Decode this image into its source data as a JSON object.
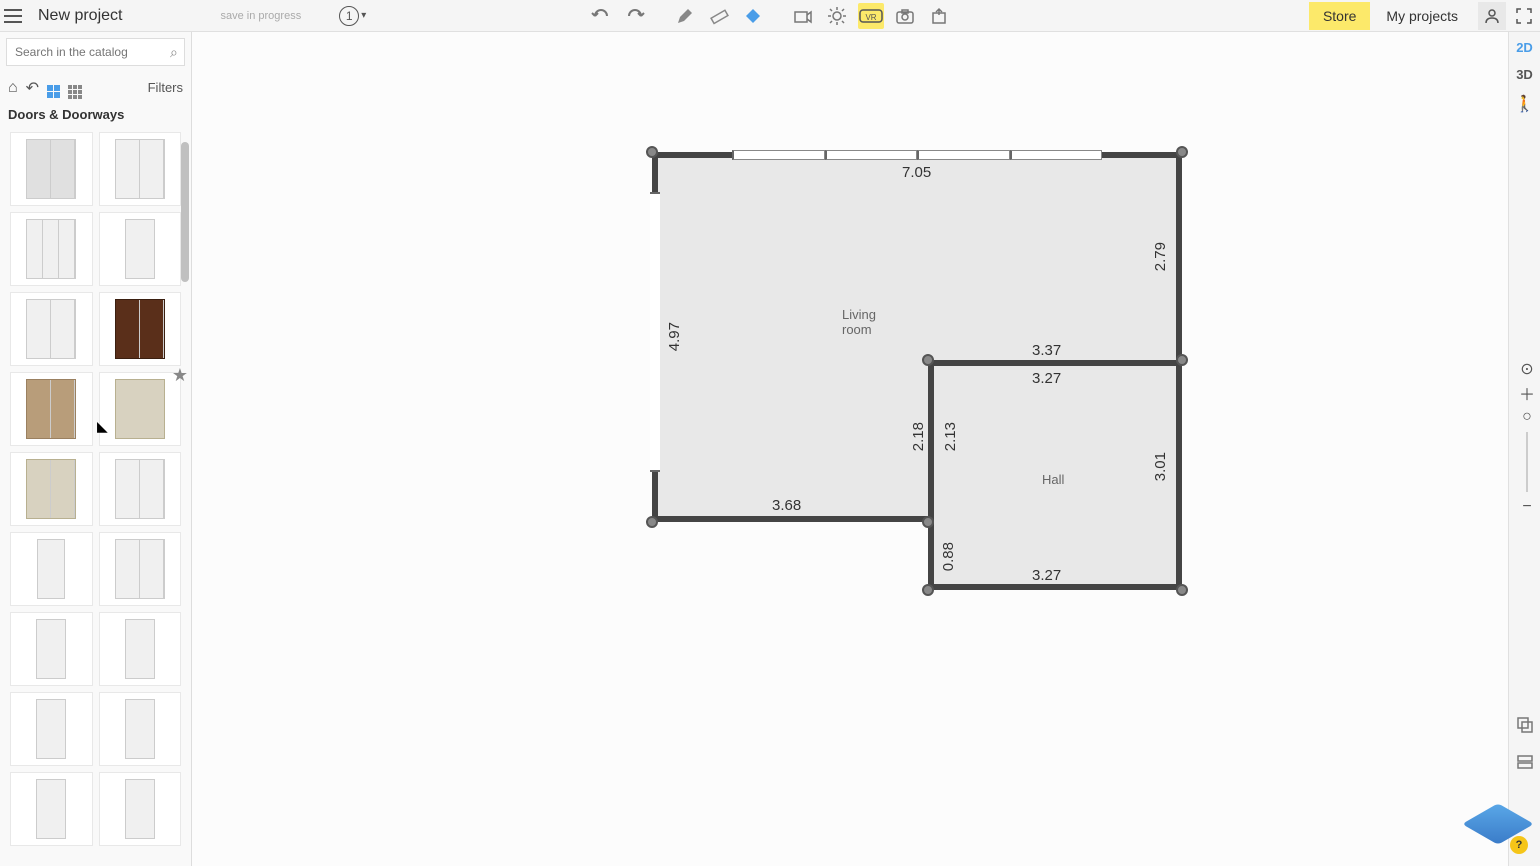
{
  "header": {
    "project_title": "New project",
    "save_status": "save in progress",
    "help_number": "1",
    "store_label": "Store",
    "my_projects_label": "My projects"
  },
  "sidebar": {
    "search_placeholder": "Search in the catalog",
    "filters_label": "Filters",
    "category_title": "Doors & Doorways"
  },
  "view_modes": {
    "two_d": "2D",
    "three_d": "3D"
  },
  "floorplan": {
    "rooms": {
      "living": {
        "label": "Living room"
      },
      "hall": {
        "label": "Hall"
      }
    },
    "dimensions": {
      "top_width": "7.05",
      "right_upper": "2.79",
      "left_height": "4.97",
      "inner_top": "3.37",
      "inner_top2": "3.27",
      "inner_left": "2.18",
      "inner_left2": "2.13",
      "right_lower": "3.01",
      "bottom_left": "3.68",
      "bottom_mid": "0.88",
      "bottom_right": "3.27"
    }
  },
  "help_badge": {
    "count": "?"
  }
}
